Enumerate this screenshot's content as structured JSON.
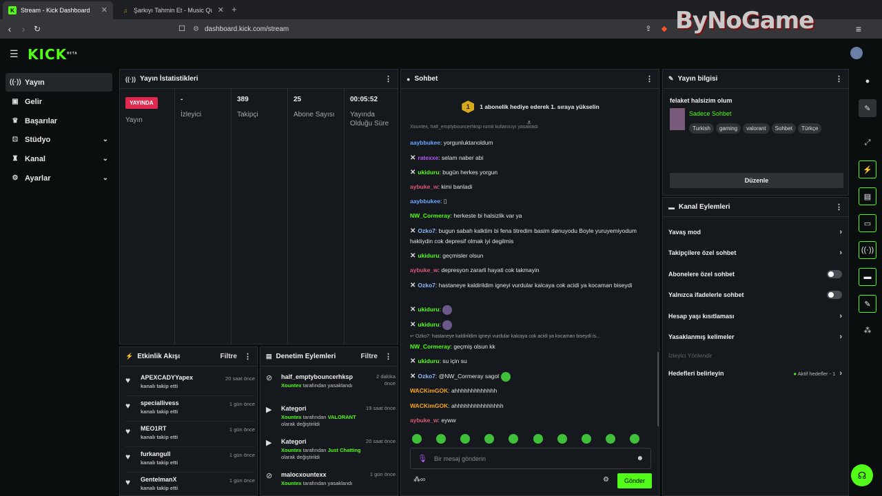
{
  "browser": {
    "tabs": [
      {
        "title": "Stream - Kick Dashboard"
      },
      {
        "title": "Şarkıyı Tahmin Et - Music Quiz - Quiz"
      }
    ],
    "url": "dashboard.kick.com/stream",
    "watermark": "ByNoGame"
  },
  "header": {
    "logo": "KICK",
    "logo_sup": "BETA"
  },
  "sidebar": {
    "items": [
      {
        "label": "Yayın",
        "icon": "broadcast-icon"
      },
      {
        "label": "Gelir",
        "icon": "wallet-icon"
      },
      {
        "label": "Başarılar",
        "icon": "trophy-icon"
      },
      {
        "label": "Stüdyo",
        "icon": "studio-icon"
      },
      {
        "label": "Kanal",
        "icon": "user-icon"
      },
      {
        "label": "Ayarlar",
        "icon": "gear-icon"
      }
    ]
  },
  "stats": {
    "title": "Yayın İstatistikleri",
    "live_badge": "YAYINDA",
    "cols": [
      {
        "value": "",
        "label": "Yayın"
      },
      {
        "value": "-",
        "label": "İzleyici"
      },
      {
        "value": "389",
        "label": "Takipçi"
      },
      {
        "value": "25",
        "label": "Abone Sayısı"
      },
      {
        "value": "00:05:52",
        "label": "Yayında Olduğu Süre"
      }
    ]
  },
  "activity": {
    "title": "Etkinlik Akışı",
    "filter": "Filtre",
    "items": [
      {
        "name": "APEXCADYYapex",
        "sub": "kanalı takip etti",
        "time": "20 saat önce"
      },
      {
        "name": "speciallivess",
        "sub": "kanalı takip etti",
        "time": "1 gün önce"
      },
      {
        "name": "MEO1RT",
        "sub": "kanalı takip etti",
        "time": "1 gün önce"
      },
      {
        "name": "furkangull",
        "sub": "kanalı takip etti",
        "time": "1 gün önce"
      },
      {
        "name": "GentelmanX",
        "sub": "kanalı takip etti",
        "time": "1 gün önce"
      }
    ]
  },
  "moderation": {
    "title": "Denetim Eylemleri",
    "filter": "Filtre",
    "items": [
      {
        "name": "half_emptybouncerhksp",
        "actor": "Xountex",
        "rest": "tarafından yasaklandı",
        "extra": "",
        "extra2": "",
        "time": "2 dakika önce"
      },
      {
        "name": "Kategori",
        "actor": "Xountex",
        "rest": "tarafından",
        "extra": "VALORANT",
        "extra2": "olarak değiştirildi",
        "time": "19 saat önce"
      },
      {
        "name": "Kategori",
        "actor": "Xountex",
        "rest": "tarafından",
        "extra": "Just Chatting",
        "extra2": "olarak değiştirildi",
        "time": "20 saat önce"
      },
      {
        "name": "malocxountexx",
        "actor": "Xountex",
        "rest": "tarafından yasaklandı",
        "extra": "",
        "extra2": "",
        "time": "1 gün önce"
      }
    ]
  },
  "chat": {
    "title": "Sohbet",
    "gift_number": "1",
    "gift_text": "1 abonelik hediye ederek 1. sıraya yükselin",
    "messages": [
      {
        "user": "aaybbukee",
        "color": "#6aa8ff",
        "text": "yorgunluktanoldum",
        "badge": false
      },
      {
        "user": "ratexxe",
        "color": "#b45cff",
        "text": "selam naber abi",
        "badge": true
      },
      {
        "user": "ukiduru",
        "color": "#53fc18",
        "text": "bugün herkes yorgun",
        "badge": true
      },
      {
        "user": "aybuke_w",
        "color": "#e0577a",
        "text": "kimi banladi",
        "badge": false
      },
      {
        "user": "aaybbukee",
        "color": "#6aa8ff",
        "text": "▯",
        "badge": false
      },
      {
        "user": "NW_Cormeray",
        "color": "#53fc18",
        "text": "herkeste bi halsizlik var ya",
        "badge": false
      },
      {
        "user": "Ozko7",
        "color": "#8fb7ff",
        "text": "bugun sabah kalktim bi fena titredim basim dønuyodu Boyle yuruyemiyodum hakliydin cok depresif olmak iyi degilmis",
        "badge": true
      },
      {
        "user": "ukiduru",
        "color": "#53fc18",
        "text": "geçmisler olsun",
        "badge": true
      },
      {
        "user": "aybuke_w",
        "color": "#e0577a",
        "text": "depresyon zararli hayati cok takmayin",
        "badge": false
      },
      {
        "user": "Ozko7",
        "color": "#8fb7ff",
        "text": "hastaneye kaldirildim igneyi vurdular kalcaya cok acidi ya kocaman biseydi",
        "badge": true
      },
      {
        "user": "ukiduru",
        "color": "#53fc18",
        "text": "",
        "badge": true
      },
      {
        "user": "ukiduru",
        "color": "#53fc18",
        "text": "",
        "badge": true
      },
      {
        "user": "NW_Cormeray",
        "color": "#53fc18",
        "text": "geçmiş olsun kk",
        "badge": false
      },
      {
        "user": "ukiduru",
        "color": "#53fc18",
        "text": "su için su",
        "badge": true
      },
      {
        "user": "Ozko7",
        "color": "#8fb7ff",
        "text": "@NW_Cormeray sagol",
        "badge": true
      },
      {
        "user": "WACKimGOK",
        "color": "#f5a623",
        "text": "ahhhhhhhhhhhhh",
        "badge": false
      },
      {
        "user": "WACKimGOK",
        "color": "#f5a623",
        "text": "ahhhhhhhhhhhhhhh",
        "badge": false
      },
      {
        "user": "aybuke_w",
        "color": "#e0577a",
        "text": "eyww",
        "badge": false
      }
    ],
    "top_partial": "Xountex, half_emptybouncerhksp isimli kullanıcıyı yasakladı",
    "reply_preview": "Ozko7: hastaneye kaldirildim igneyi vurdular kalcaya cok acidi ya kocaman biseydi is...",
    "input_placeholder": "Bir mesaj gönderin",
    "send_label": "Gönder"
  },
  "stream_info": {
    "title": "Yayın bilgisi",
    "stream_title": "felaket halsizim olum",
    "category": "Sadece Sohbet",
    "tags": [
      "Turkish",
      "gaming",
      "valorant",
      "Sohbet",
      "Türkçe"
    ],
    "edit_label": "Düzenle"
  },
  "channel_actions": {
    "title": "Kanal Eylemleri",
    "items": [
      {
        "label": "Yavaş mod",
        "kind": "chevron"
      },
      {
        "label": "Takipçilere özel sohbet",
        "kind": "chevron"
      },
      {
        "label": "Abonelere özel sohbet",
        "kind": "toggle"
      },
      {
        "label": "Yalnızca ifadelerle sohbet",
        "kind": "toggle"
      },
      {
        "label": "Hesap yaşı kısıtlaması",
        "kind": "chevron"
      },
      {
        "label": "Yasaklanmış kelimeler",
        "kind": "chevron"
      }
    ],
    "section_label": "İzleyici Yönlendir",
    "goals_label": "Hedefleri belirleyin",
    "goals_status": "Aktif hedefler - 1"
  },
  "colors": {
    "accent": "#53fc18",
    "live": "#e0294f",
    "panel": "#15181c"
  }
}
